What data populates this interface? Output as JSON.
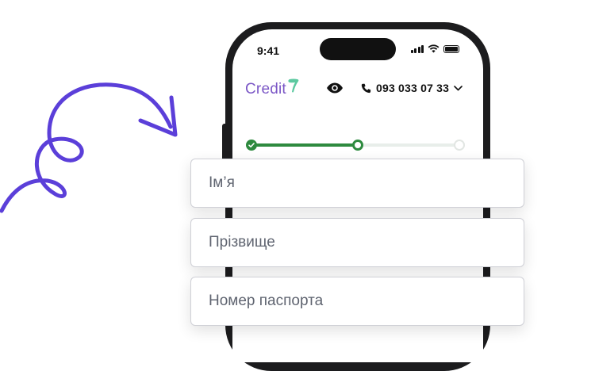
{
  "status_bar": {
    "time": "9:41"
  },
  "header": {
    "logo_text": "Credit",
    "logo_mark": "7",
    "phone_number": "093 033 07 33"
  },
  "progress": {
    "total_steps": 3,
    "current_step": 2
  },
  "form": {
    "first_name_placeholder": "Ім’я",
    "last_name_placeholder": "Прізвище",
    "passport_placeholder": "Номер паспорта"
  },
  "colors": {
    "brand_purple": "#7b57c6",
    "brand_green": "#5cc9a0",
    "progress_green": "#2e8a3f",
    "arrow_purple": "#5b3fd9"
  }
}
